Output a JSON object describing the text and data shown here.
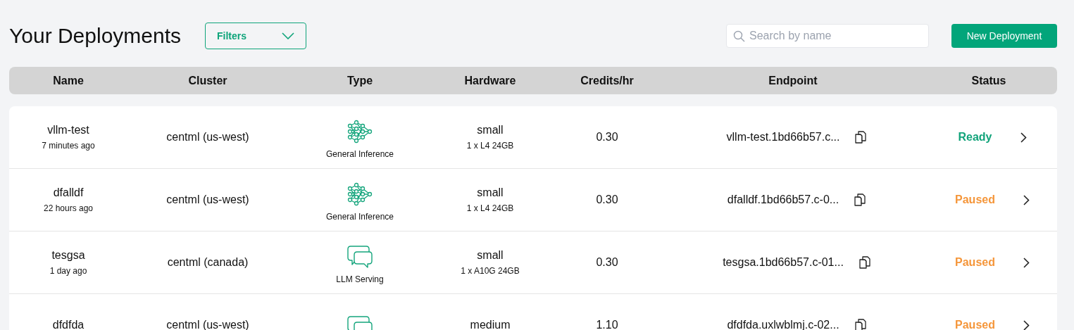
{
  "title": "Your Deployments",
  "filters": {
    "label": "Filters"
  },
  "search": {
    "placeholder": "Search by name"
  },
  "new_button": {
    "label": "New Deployment"
  },
  "table": {
    "columns": [
      "Name",
      "Cluster",
      "Type",
      "Hardware",
      "Credits/hr",
      "Endpoint",
      "Status"
    ],
    "rows": [
      {
        "name": "vllm-test",
        "created": "7 minutes ago",
        "cluster": "centml (us-west)",
        "type": {
          "kind": "inference",
          "label": "General Inference"
        },
        "hardware": "small",
        "hardware_detail": "1 x L4 24GB",
        "credits": "0.30",
        "endpoint": "vllm-test.1bd66b57.c...",
        "status": {
          "kind": "ready",
          "label": "Ready"
        }
      },
      {
        "name": "dfalldf",
        "created": "22 hours ago",
        "cluster": "centml (us-west)",
        "type": {
          "kind": "inference",
          "label": "General Inference"
        },
        "hardware": "small",
        "hardware_detail": "1 x L4 24GB",
        "credits": "0.30",
        "endpoint": "dfalldf.1bd66b57.c-0...",
        "status": {
          "kind": "paused",
          "label": "Paused"
        }
      },
      {
        "name": "tesgsa",
        "created": "1 day ago",
        "cluster": "centml (canada)",
        "type": {
          "kind": "llm",
          "label": "LLM Serving"
        },
        "hardware": "small",
        "hardware_detail": "1 x A10G 24GB",
        "credits": "0.30",
        "endpoint": "tesgsa.1bd66b57.c-01...",
        "status": {
          "kind": "paused",
          "label": "Paused"
        }
      },
      {
        "name": "dfdfda",
        "cluster": "centml (us-west)",
        "type": {
          "kind": "llm"
        },
        "hardware": "medium",
        "credits": "1.10",
        "endpoint": "dfdfda.uxlwblmj.c-02...",
        "status": {
          "kind": "paused",
          "label": "Paused"
        }
      }
    ]
  }
}
